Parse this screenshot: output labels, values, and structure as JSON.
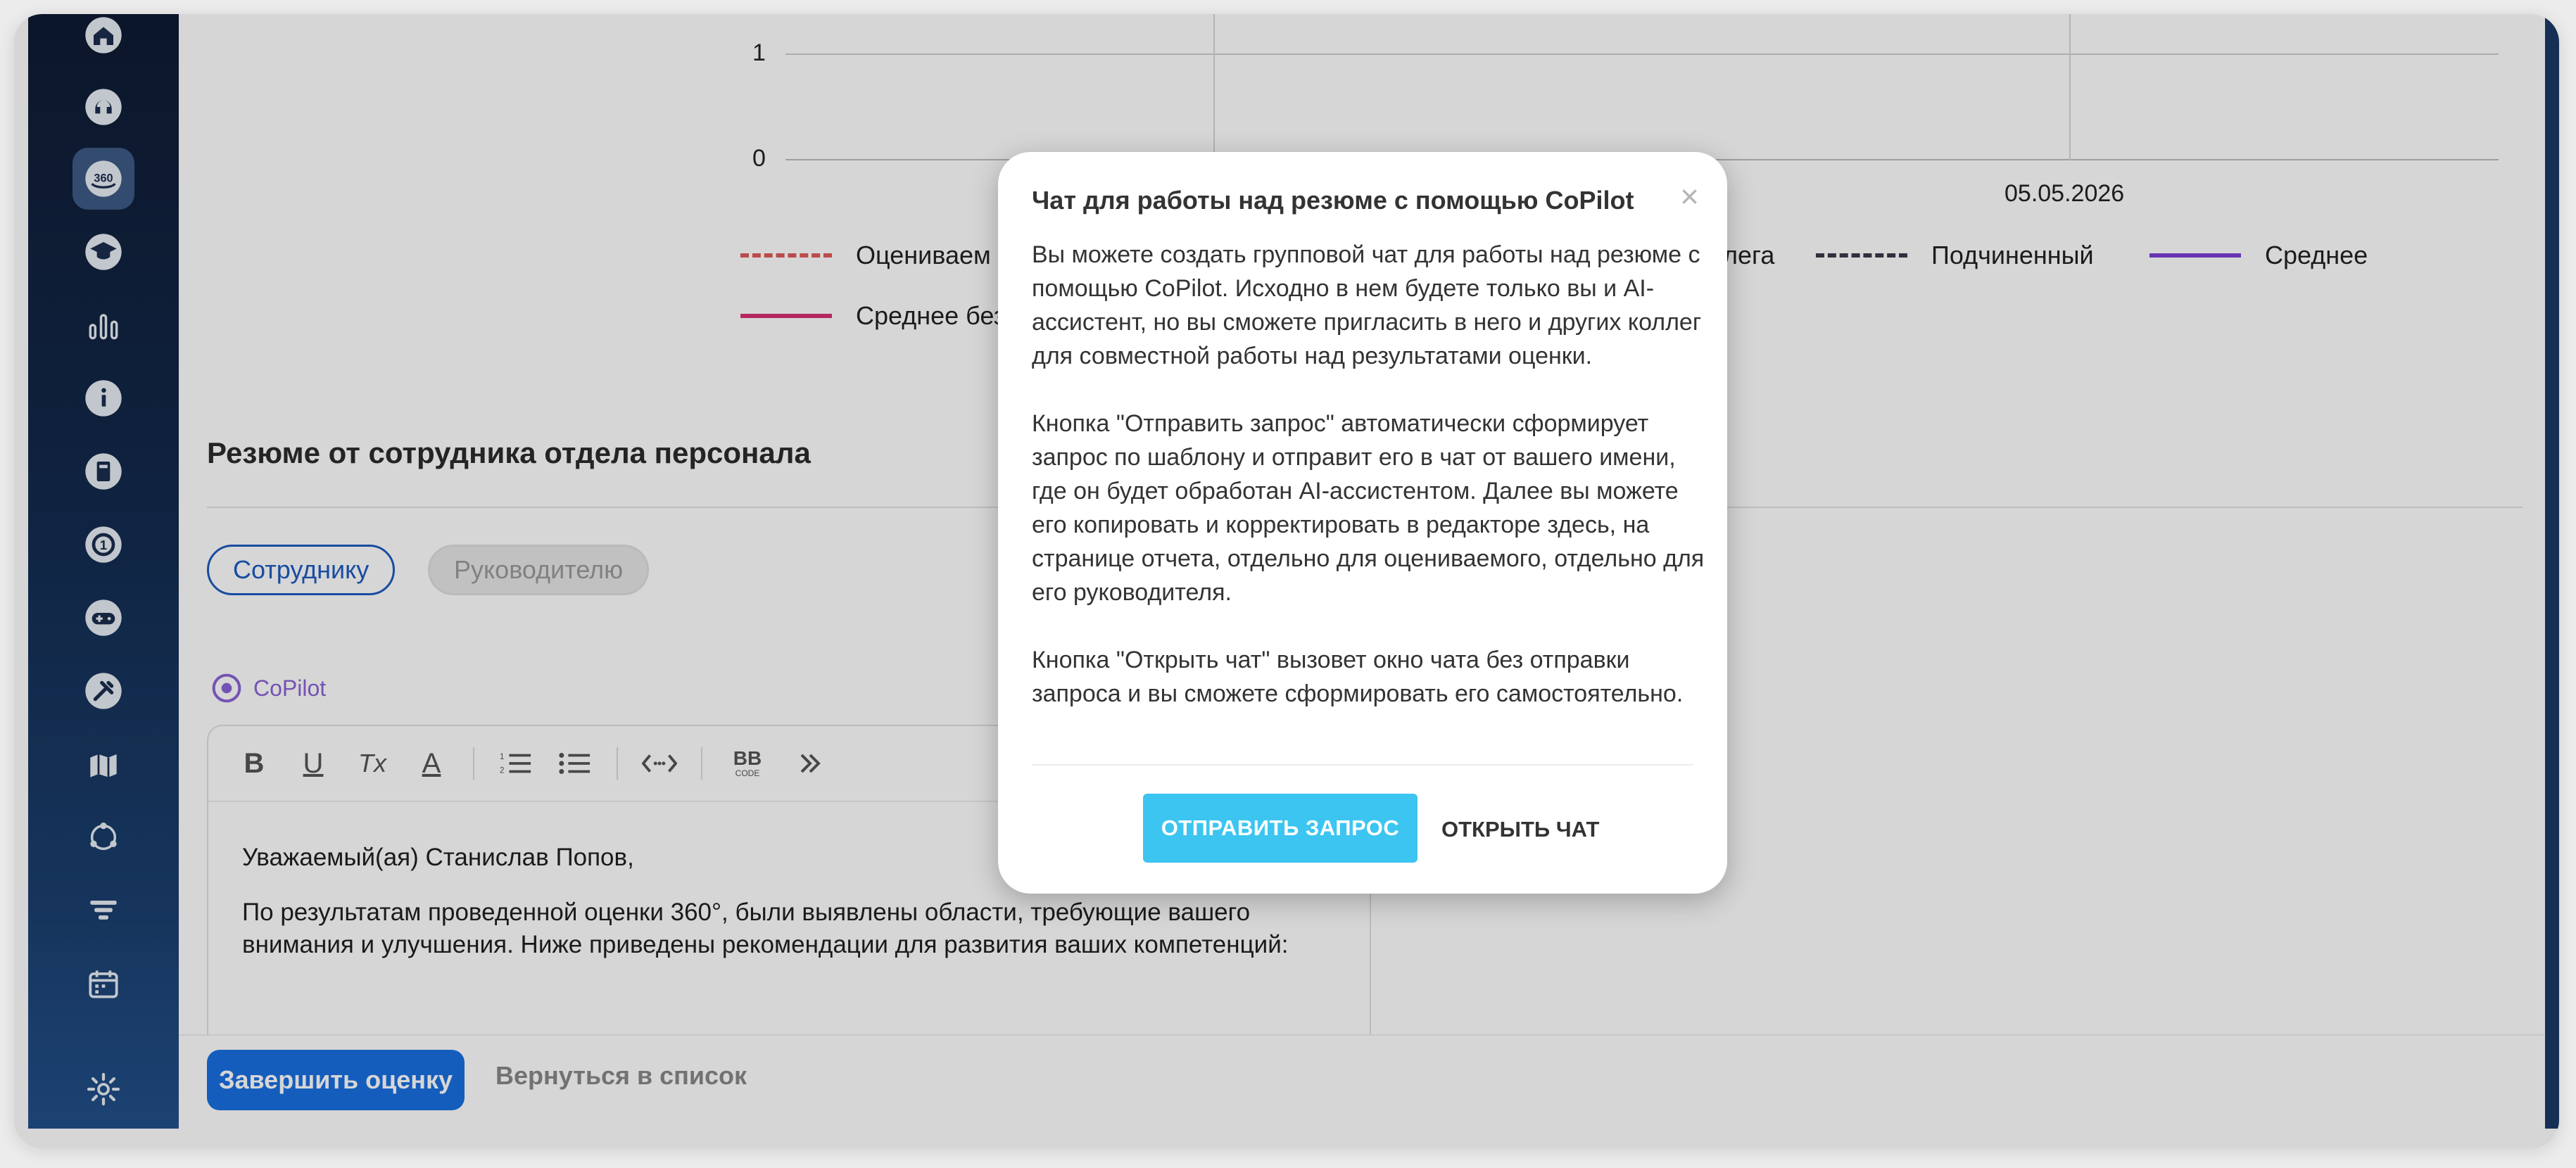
{
  "sidebar": {
    "items": [
      {
        "icon": "home-icon"
      },
      {
        "icon": "headset-icon"
      },
      {
        "icon": "rotate-360-icon",
        "label": "360",
        "active": true
      },
      {
        "icon": "graduation-cap-icon"
      },
      {
        "icon": "bar-chart-icon"
      },
      {
        "icon": "info-icon"
      },
      {
        "icon": "book-icon"
      },
      {
        "icon": "target-icon"
      },
      {
        "icon": "gamepad-icon"
      },
      {
        "icon": "tools-icon"
      },
      {
        "icon": "map-icon"
      },
      {
        "icon": "network-icon"
      },
      {
        "icon": "funnel-icon"
      },
      {
        "icon": "calendar-icon"
      },
      {
        "icon": "gear-icon"
      }
    ]
  },
  "chart": {
    "ticks": [
      "1",
      "0"
    ],
    "x_label": "05.05.2026",
    "legend": [
      {
        "label": "Оцениваем",
        "color": "#e05a5a",
        "style": "dashed"
      },
      {
        "label": "лега",
        "color": "#333333",
        "style": "dashed"
      },
      {
        "label": "Подчиненный",
        "color": "#3a3a4a",
        "style": "dashed"
      },
      {
        "label": "Среднее",
        "color": "#7b3fd6",
        "style": "solid"
      },
      {
        "label": "Среднее без",
        "color": "#d92f72",
        "style": "solid"
      }
    ]
  },
  "summary": {
    "title": "Резюме от сотрудника отдела персонала",
    "tabs": [
      "Сотруднику",
      "Руководителю"
    ],
    "copilot_label": "CoPilot"
  },
  "editor": {
    "toolbar": [
      "B",
      "U",
      "Tx",
      "A",
      "numbered-list",
      "bullet-list",
      "code",
      "bbcode",
      "more"
    ],
    "bbcode_label": "BB",
    "bbcode_sub": "CODE",
    "greeting": "Уважаемый(ая) Станислав Попов,",
    "body": "По результатам проведенной оценки 360°, были выявлены области, требующие вашего внимания и улучшения. Ниже приведены рекомендации для развития ваших компетенций:"
  },
  "footer": {
    "finish_label": "Завершить оценку",
    "back_label": "Вернуться в список"
  },
  "modal": {
    "title": "Чат для работы над резюме с помощью CoPilot",
    "close": "×",
    "p1": "Вы можете создать групповой чат для работы над резюме с помощью CoPilot. Исходно в нем будете только вы и AI-ассистент, но вы сможете пригласить в него и других коллег для совместной работы над результатами оценки.",
    "p2": "Кнопка \"Отправить запрос\" автоматически сформирует запрос по шаблону и отправит его в чат от вашего имени, где он будет обработан AI-ассистентом. Далее вы можете его копировать и корректировать в редакторе здесь, на странице отчета, отдельно для оцениваемого, отдельно для его руководителя.",
    "p3": "Кнопка \"Открыть чат\" вызовет окно чата без отправки запроса и вы сможете сформировать его самостоятельно.",
    "send_label": "ОТПРАВИТЬ ЗАПРОС",
    "open_label": "ОТКРЫТЬ ЧАТ"
  }
}
